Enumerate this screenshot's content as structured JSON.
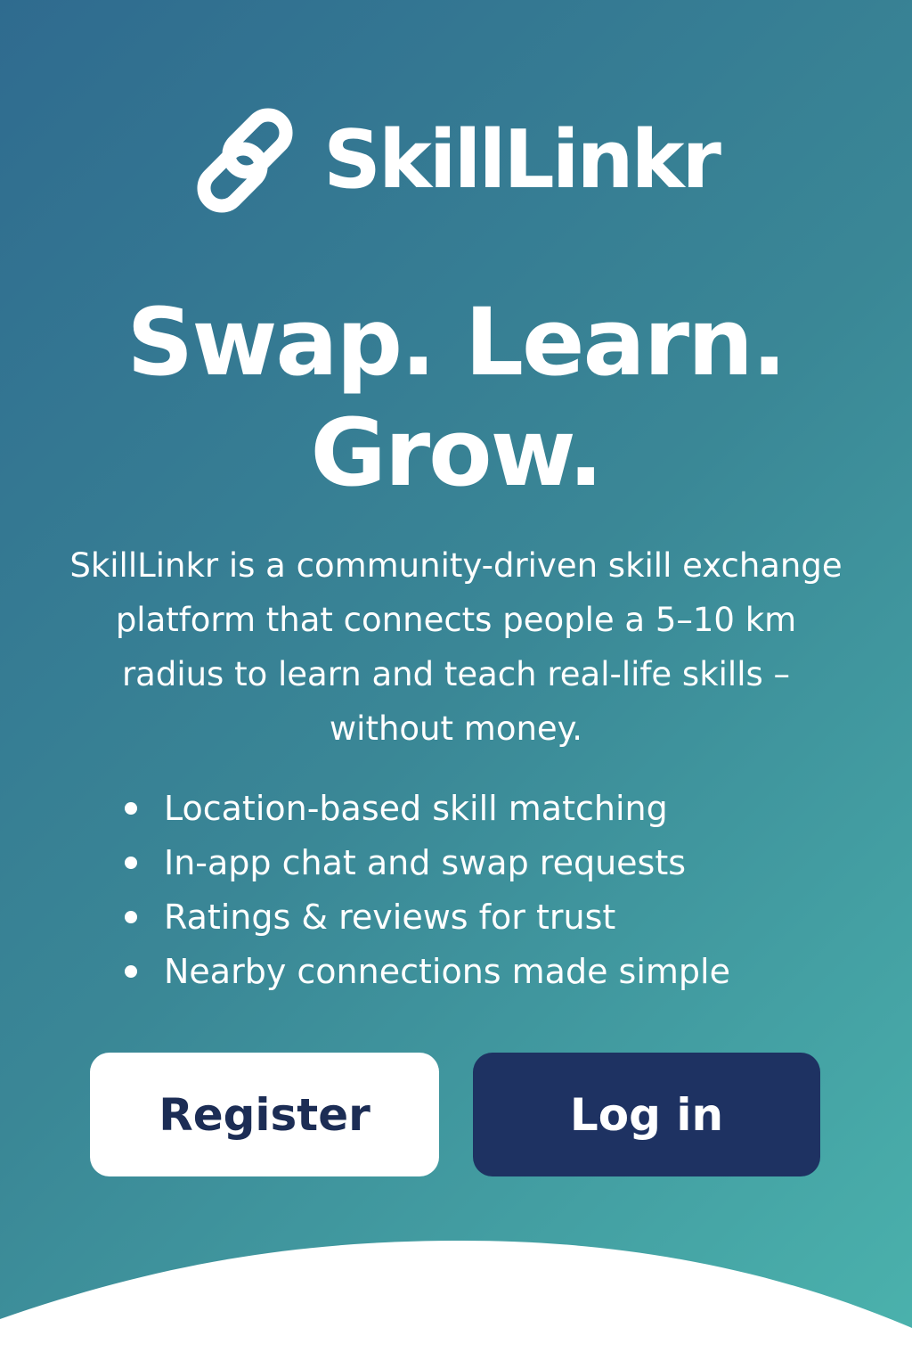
{
  "brand": {
    "name": "SkillLinkr",
    "logo_icon": "link-chain-icon"
  },
  "hero": {
    "headline_line1": "Swap. Learn.",
    "headline_line2": "Grow.",
    "description": "SkillLinkr is a community-driven skill exchange platform that connects people a 5–10 km radius to learn and teach real-life skills – without money."
  },
  "features": [
    "Location-based skill matching",
    "In-app chat and swap requests",
    "Ratings & reviews for trust",
    "Nearby connections made simple"
  ],
  "actions": {
    "register_label": "Register",
    "login_label": "Log in"
  },
  "colors": {
    "gradient_start": "#2f6b8f",
    "gradient_end": "#4bb3ad",
    "login_button": "#1e3262",
    "register_text": "#1c2d55",
    "text": "#ffffff"
  }
}
